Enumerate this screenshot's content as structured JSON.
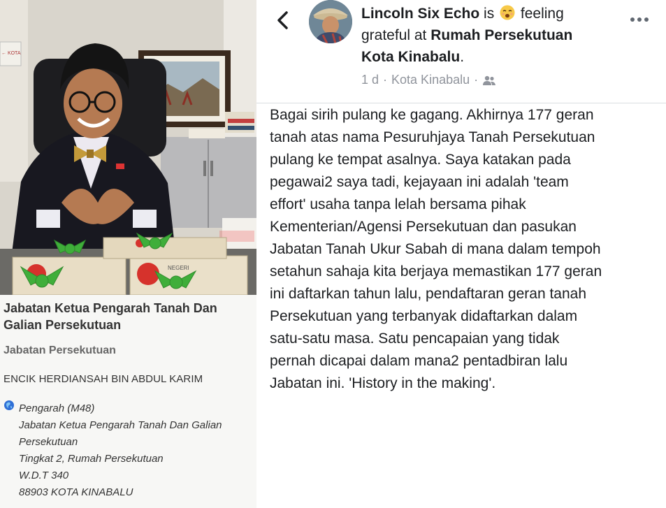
{
  "left_panel": {
    "directory": {
      "title_line1": "Jabatan Ketua Pengarah Tanah Dan",
      "title_line2": "Galian Persekutuan",
      "department": "Jabatan Persekutuan",
      "person_name": "ENCIK HERDIANSAH BIN ABDUL KARIM",
      "position": "Pengarah (M48)",
      "address_lines": [
        "Jabatan Ketua Pengarah Tanah Dan Galian",
        "Persekutuan",
        "Tingkat 2, Rumah Persekutuan",
        "W.D.T 340",
        "88903 KOTA KINABALU"
      ],
      "icon": "globe-icon"
    },
    "photo": {
      "sign_text": "← KOTA",
      "gift_label": "NEGERI"
    }
  },
  "right_panel": {
    "post": {
      "author": "Lincoln Six Echo",
      "is_text": "is",
      "feeling_text": "feeling",
      "grateful_at": "grateful at",
      "location_line1": "Rumah Persekutuan",
      "location_line2": "Kota Kinabalu",
      "location_period": ".",
      "time": "1 d",
      "place": "Kota Kinabalu",
      "separator": "·",
      "audience_icon": "friends-icon",
      "feeling_icon": "grateful-emoji-icon",
      "body_lines": [
        "Bagai sirih pulang ke gagang. Akhirnya 177 geran",
        "tanah atas nama Pesuruhjaya Tanah Persekutuan",
        "pulang ke tempat asalnya. Saya katakan pada",
        "pegawai2 saya tadi, kejayaan ini adalah 'team",
        "effort' usaha tanpa lelah bersama pihak",
        "Kementerian/Agensi Persekutuan dan pasukan",
        "Jabatan Tanah Ukur Sabah di mana dalam tempoh",
        "setahun sahaja kita berjaya memastikan 177 geran",
        "ini daftarkan tahun lalu, pendaftaran geran tanah",
        "Persekutuan yang terbanyak didaftarkan dalam",
        "satu-satu masa. Satu pencapaian yang tidak",
        "pernah dicapai dalam mana2 pentadbiran lalu",
        "Jabatan ini. 'History in the making'."
      ]
    },
    "icons": {
      "back": "chevron-left-icon",
      "more": "more-options-icon"
    }
  },
  "colors": {
    "text_primary": "#1c1e21",
    "text_meta": "#90949c",
    "divider": "#dadde1",
    "directory_text": "#333333",
    "directory_dept": "#666666",
    "gift_ribbon": "#3fae3a"
  }
}
